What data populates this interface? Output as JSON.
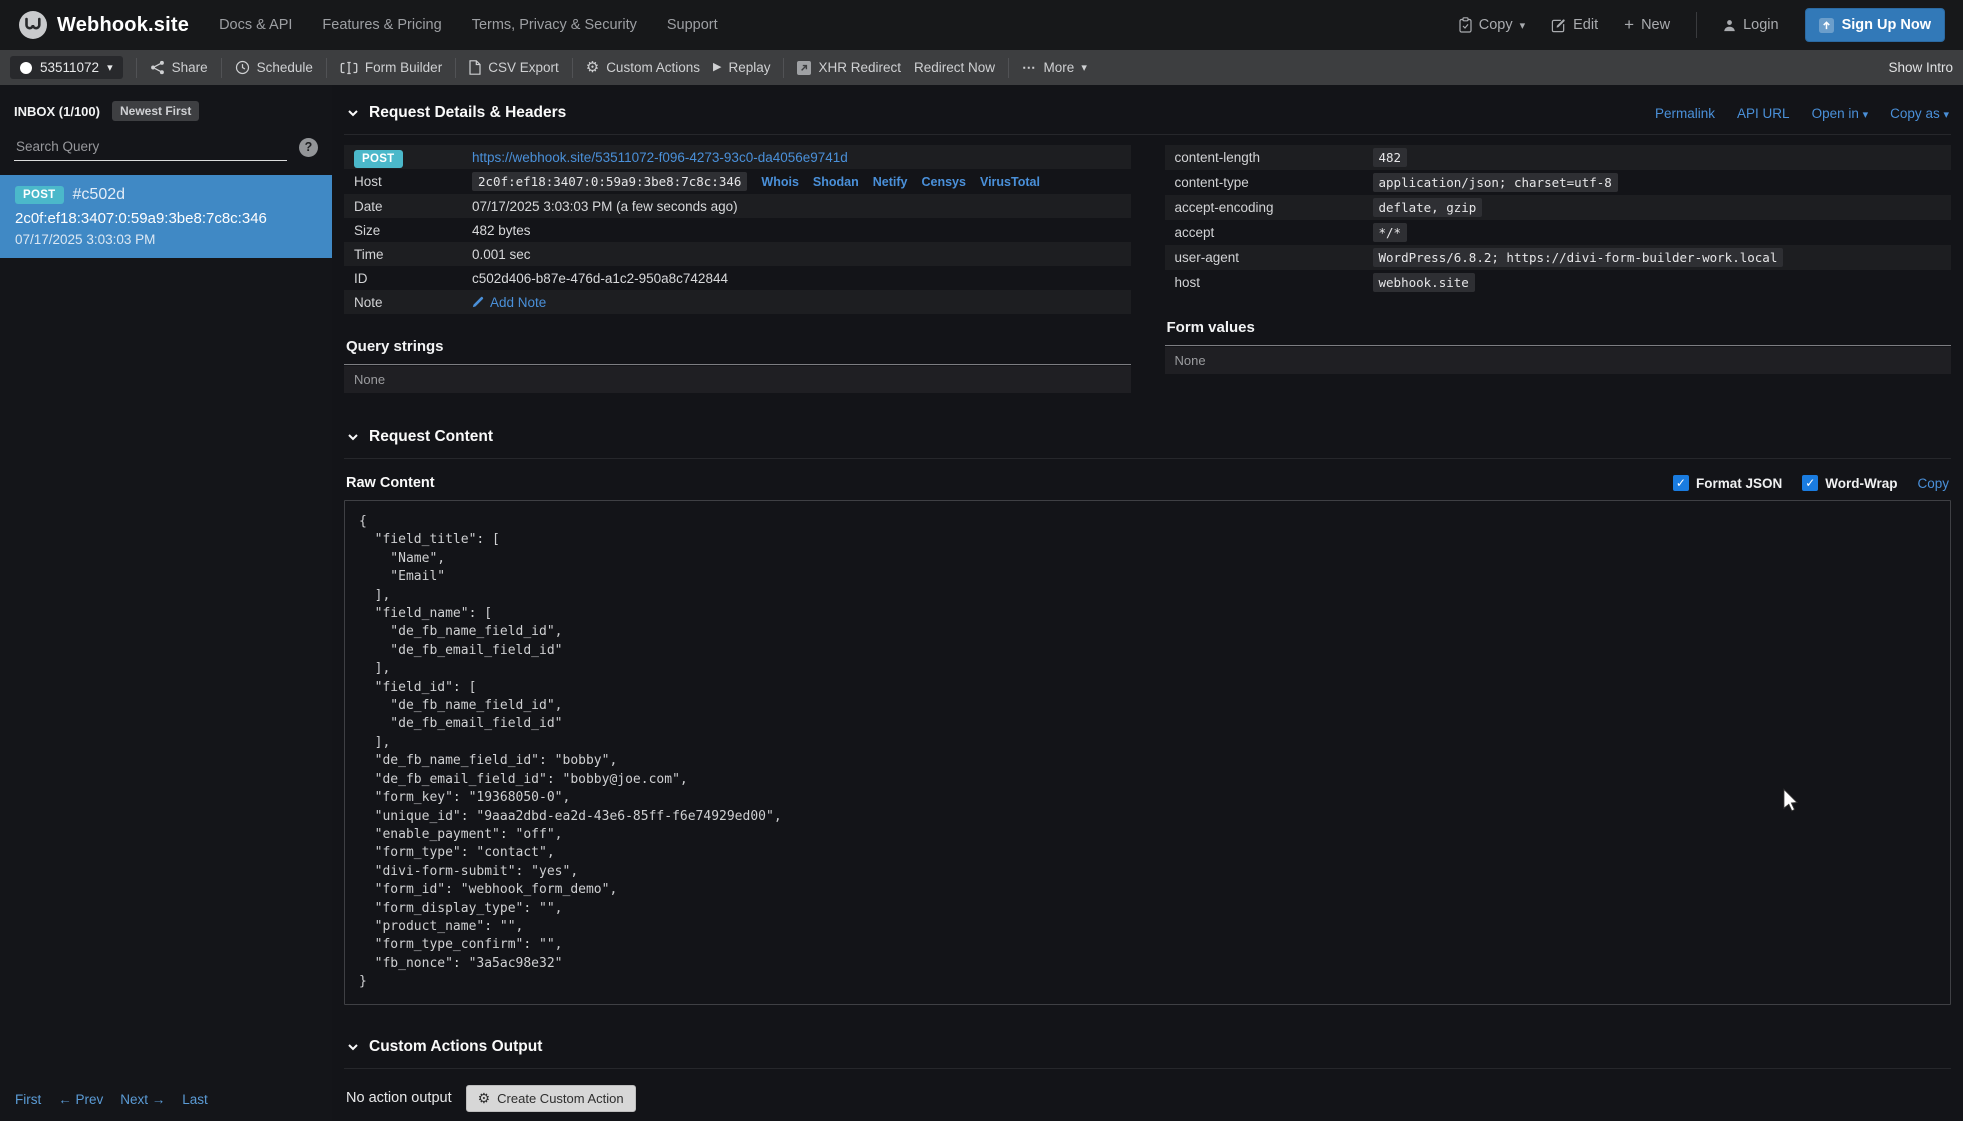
{
  "navbar": {
    "brand": "Webhook.site",
    "links": [
      "Docs & API",
      "Features & Pricing",
      "Terms, Privacy & Security",
      "Support"
    ],
    "copy_label": "Copy",
    "edit_label": "Edit",
    "new_label": "New",
    "login_label": "Login",
    "signup_label": "Sign Up Now"
  },
  "toolbar": {
    "token_id": "53511072",
    "share": "Share",
    "schedule": "Schedule",
    "form_builder": "Form Builder",
    "csv_export": "CSV Export",
    "custom_actions": "Custom Actions",
    "replay": "Replay",
    "xhr_redirect": "XHR Redirect",
    "redirect_now": "Redirect Now",
    "more": "More",
    "show_intro": "Show Intro"
  },
  "sidebar": {
    "inbox_label": "INBOX (1/100)",
    "sort_badge": "Newest First",
    "search_placeholder": "Search Query",
    "help_label": "?",
    "request": {
      "method": "POST",
      "id_short": "#c502d",
      "ip": "2c0f:ef18:3407:0:59a9:3be8:7c8c:346",
      "time": "07/17/2025 3:03:03 PM"
    },
    "pagination": {
      "first": "First",
      "prev": "← Prev",
      "next": "Next →",
      "last": "Last"
    }
  },
  "details": {
    "title": "Request Details & Headers",
    "links": {
      "permalink": "Permalink",
      "api_url": "API URL",
      "open_in": "Open in",
      "copy_as": "Copy as"
    },
    "method": "POST",
    "url": "https://webhook.site/53511072-f096-4273-93c0-da4056e9741d",
    "host_label": "Host",
    "host_value": "2c0f:ef18:3407:0:59a9:3be8:7c8c:346",
    "host_links": [
      "Whois",
      "Shodan",
      "Netify",
      "Censys",
      "VirusTotal"
    ],
    "date_label": "Date",
    "date_value": "07/17/2025 3:03:03 PM (a few seconds ago)",
    "size_label": "Size",
    "size_value": "482 bytes",
    "time_label": "Time",
    "time_value": "0.001 sec",
    "id_label": "ID",
    "id_value": "c502d406-b87e-476d-a1c2-950a8c742844",
    "note_label": "Note",
    "note_value": "Add Note"
  },
  "headers": {
    "rows": [
      {
        "name": "content-length",
        "value": "482"
      },
      {
        "name": "content-type",
        "value": "application/json; charset=utf-8"
      },
      {
        "name": "accept-encoding",
        "value": "deflate, gzip"
      },
      {
        "name": "accept",
        "value": "*/*"
      },
      {
        "name": "user-agent",
        "value": "WordPress/6.8.2; https://divi-form-builder-work.local"
      },
      {
        "name": "host",
        "value": "webhook.site"
      }
    ]
  },
  "query_strings": {
    "title": "Query strings",
    "empty": "None"
  },
  "form_values": {
    "title": "Form values",
    "empty": "None"
  },
  "request_content": {
    "title": "Request Content",
    "raw_label": "Raw Content",
    "format_json_label": "Format JSON",
    "word_wrap_label": "Word-Wrap",
    "copy_label": "Copy",
    "checkmark": "✓",
    "body": "{\n  \"field_title\": [\n    \"Name\",\n    \"Email\"\n  ],\n  \"field_name\": [\n    \"de_fb_name_field_id\",\n    \"de_fb_email_field_id\"\n  ],\n  \"field_id\": [\n    \"de_fb_name_field_id\",\n    \"de_fb_email_field_id\"\n  ],\n  \"de_fb_name_field_id\": \"bobby\",\n  \"de_fb_email_field_id\": \"bobby@joe.com\",\n  \"form_key\": \"19368050-0\",\n  \"unique_id\": \"9aaa2dbd-ea2d-43e6-85ff-f6e74929ed00\",\n  \"enable_payment\": \"off\",\n  \"form_type\": \"contact\",\n  \"divi-form-submit\": \"yes\",\n  \"form_id\": \"webhook_form_demo\",\n  \"form_display_type\": \"\",\n  \"product_name\": \"\",\n  \"form_type_confirm\": \"\",\n  \"fb_nonce\": \"3a5ac98e32\"\n}"
  },
  "custom_actions_output": {
    "title": "Custom Actions Output",
    "empty": "No action output",
    "create_button": "Create Custom Action"
  },
  "colors": {
    "accent_blue": "#4a90d9",
    "selected_item_blue": "#4089c5",
    "method_badge_teal": "#4bb8ca",
    "signup_button_blue": "#3279b8"
  }
}
